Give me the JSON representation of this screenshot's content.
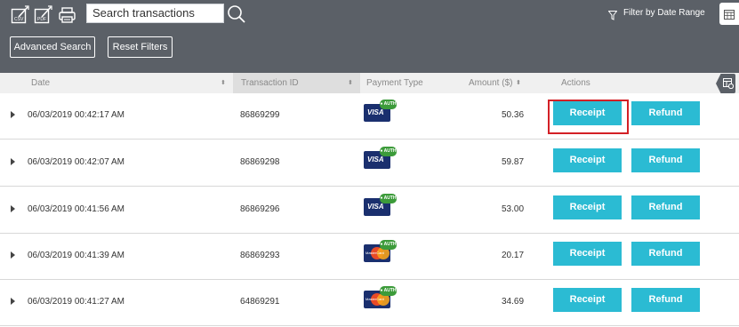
{
  "toolbar": {
    "icons": [
      "csv-export-icon",
      "pdf-export-icon",
      "print-icon"
    ],
    "search": {
      "value": "Search transactions"
    },
    "filter_label": "Filter by Date Range",
    "advanced_search": "Advanced Search",
    "reset_filters": "Reset Filters"
  },
  "table": {
    "headers": {
      "date": "Date",
      "transaction_id": "Transaction ID",
      "payment_type": "Payment Type",
      "amount": "Amount ($)",
      "actions": "Actions"
    },
    "rows": [
      {
        "date": "06/03/2019 00:42:17 AM",
        "id": "86869299",
        "card": "visa",
        "badge": "● AUTH",
        "card_text": "VISA",
        "amount": "50.36",
        "receipt": "Receipt",
        "refund": "Refund"
      },
      {
        "date": "06/03/2019 00:42:07 AM",
        "id": "86869298",
        "card": "visa",
        "badge": "● AUTH",
        "card_text": "VISA",
        "amount": "59.87",
        "receipt": "Receipt",
        "refund": "Refund"
      },
      {
        "date": "06/03/2019 00:41:56 AM",
        "id": "86869296",
        "card": "visa",
        "badge": "● AUTH",
        "card_text": "VISA",
        "amount": "53.00",
        "receipt": "Receipt",
        "refund": "Refund"
      },
      {
        "date": "06/03/2019 00:41:39 AM",
        "id": "86869293",
        "card": "mastercard",
        "badge": "● AUTH",
        "card_text": "MasterCard",
        "amount": "20.17",
        "receipt": "Receipt",
        "refund": "Refund"
      },
      {
        "date": "06/03/2019 00:41:27 AM",
        "id": "64869291",
        "card": "mastercard",
        "badge": "● AUTH",
        "card_text": "MasterCard",
        "amount": "34.69",
        "receipt": "Receipt",
        "refund": "Refund"
      }
    ]
  },
  "colors": {
    "toolbar": "#5b6067",
    "action_button": "#2bbbd3",
    "highlight": "#d32026",
    "auth_badge": "#3c9b3a"
  }
}
